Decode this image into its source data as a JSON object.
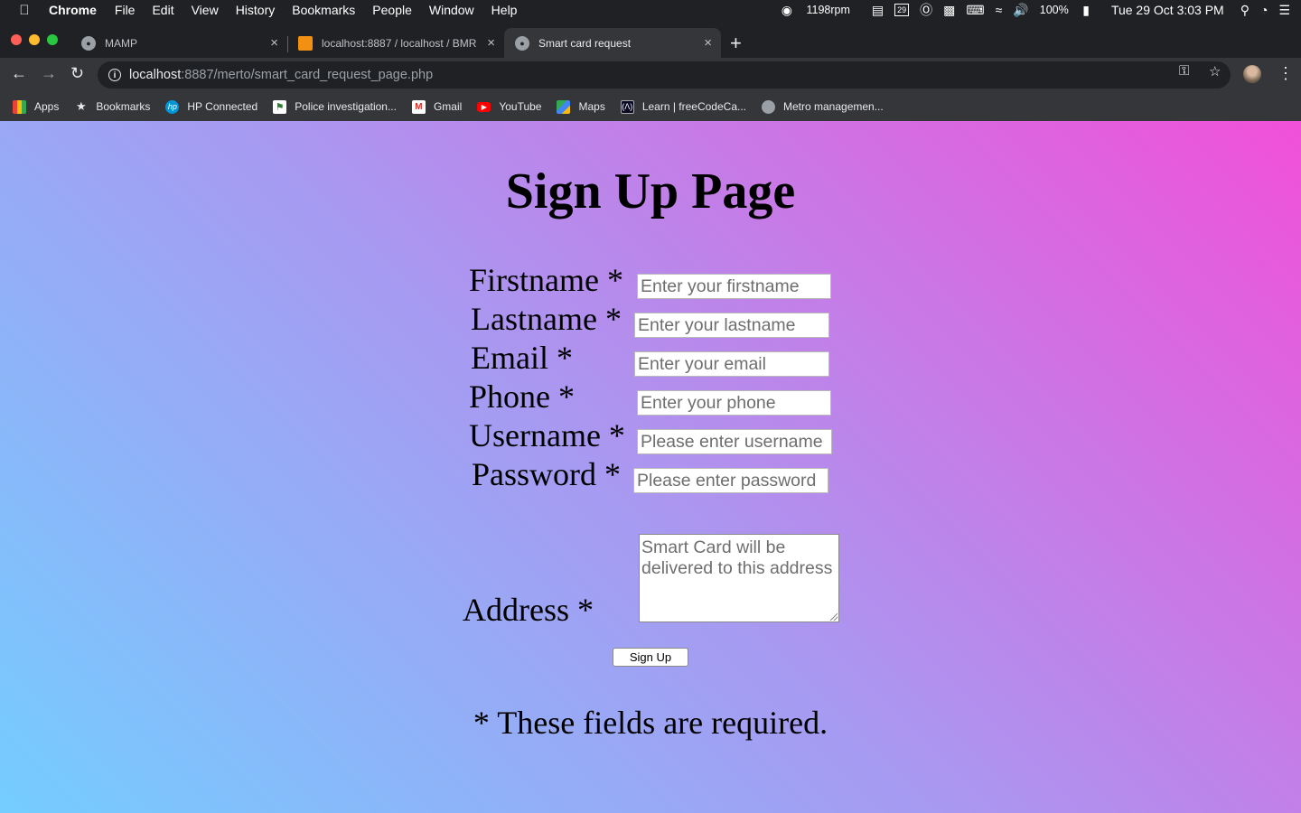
{
  "menubar": {
    "app": "Chrome",
    "items": [
      "File",
      "Edit",
      "View",
      "History",
      "Bookmarks",
      "People",
      "Window",
      "Help"
    ],
    "status": {
      "fan": "1198rpm",
      "calendar_day": "29",
      "battery": "100%",
      "clock": "Tue 29 Oct  3:03 PM"
    }
  },
  "tabs": [
    {
      "title": "MAMP",
      "close": "×"
    },
    {
      "title": "localhost:8887 / localhost / BMR",
      "close": "×"
    },
    {
      "title": "Smart card request",
      "close": "×"
    }
  ],
  "toolbar": {
    "url_host": "localhost",
    "url_path": ":8887/merto/smart_card_request_page.php"
  },
  "bookmarks": [
    {
      "label": "Apps",
      "icon": "apps-grid-icon"
    },
    {
      "label": "Bookmarks",
      "icon": "star-icon"
    },
    {
      "label": "HP Connected",
      "icon": "hp-icon"
    },
    {
      "label": "Police investigation...",
      "icon": "police-icon"
    },
    {
      "label": "Gmail",
      "icon": "gmail-icon"
    },
    {
      "label": "YouTube",
      "icon": "youtube-icon"
    },
    {
      "label": "Maps",
      "icon": "maps-icon"
    },
    {
      "label": "Learn | freeCodeCa...",
      "icon": "freecodecamp-icon"
    },
    {
      "label": "Metro managemen...",
      "icon": "mamp-icon"
    }
  ],
  "page": {
    "heading": "Sign Up Page",
    "fields": {
      "firstname": {
        "label": "Firstname *",
        "placeholder": "Enter your firstname"
      },
      "lastname": {
        "label": "Lastname *",
        "placeholder": "Enter your lastname"
      },
      "email": {
        "label": "Email *",
        "placeholder": "Enter your email"
      },
      "phone": {
        "label": "Phone *",
        "placeholder": "Enter your phone"
      },
      "username": {
        "label": "Username *",
        "placeholder": "Please enter username"
      },
      "password": {
        "label": "Password *",
        "placeholder": "Please enter password"
      },
      "address": {
        "label": "Address *",
        "placeholder": "Smart Card will be delivered to this address"
      }
    },
    "submit_label": "Sign Up",
    "required_note": "* These fields are required."
  },
  "colors": {
    "gradient_start": "#74cdff",
    "gradient_mid": "#a59cf2",
    "gradient_end": "#f150d8"
  }
}
